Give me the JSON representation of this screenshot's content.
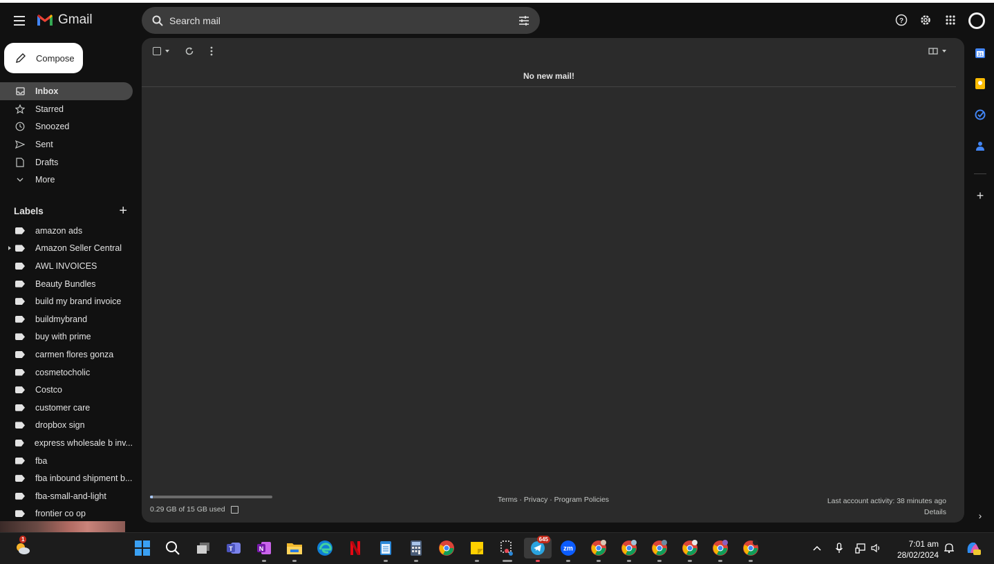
{
  "app": {
    "name": "Gmail"
  },
  "search": {
    "placeholder": "Search mail"
  },
  "compose_label": "Compose",
  "nav": [
    {
      "label": "Inbox",
      "icon": "inbox-icon",
      "active": true
    },
    {
      "label": "Starred",
      "icon": "star-icon"
    },
    {
      "label": "Snoozed",
      "icon": "clock-icon"
    },
    {
      "label": "Sent",
      "icon": "send-icon"
    },
    {
      "label": "Drafts",
      "icon": "draft-icon"
    },
    {
      "label": "More",
      "icon": "chevron-down-icon"
    }
  ],
  "labels_heading": "Labels",
  "labels": [
    "amazon ads",
    "Amazon Seller Central",
    "AWL INVOICES",
    "Beauty Bundles",
    "build my brand invoice",
    "buildmybrand",
    "buy with prime",
    "carmen flores gonza",
    "cosmetocholic",
    "Costco",
    "customer care",
    "dropbox sign",
    "express wholesale b inv...",
    "fba",
    "fba inbound shipment b...",
    "fba-small-and-light",
    "frontier co op"
  ],
  "main": {
    "empty_message": "No new mail!",
    "storage_text": "0.29 GB of 15 GB used",
    "storage_fraction": 0.02,
    "footer_links": "Terms · Privacy · Program Policies",
    "last_activity": "Last account activity: 38 minutes ago",
    "details_link": "Details"
  },
  "taskbar": {
    "weather_badge": "1",
    "telegram_badge": "645",
    "time": "7:01 am",
    "date": "28/02/2024",
    "zoom_label": "zm"
  },
  "colors": {
    "background": "#111111",
    "panel": "#2b2b2b",
    "active_nav": "#474747",
    "storage_fill": "#a8c7fa"
  }
}
